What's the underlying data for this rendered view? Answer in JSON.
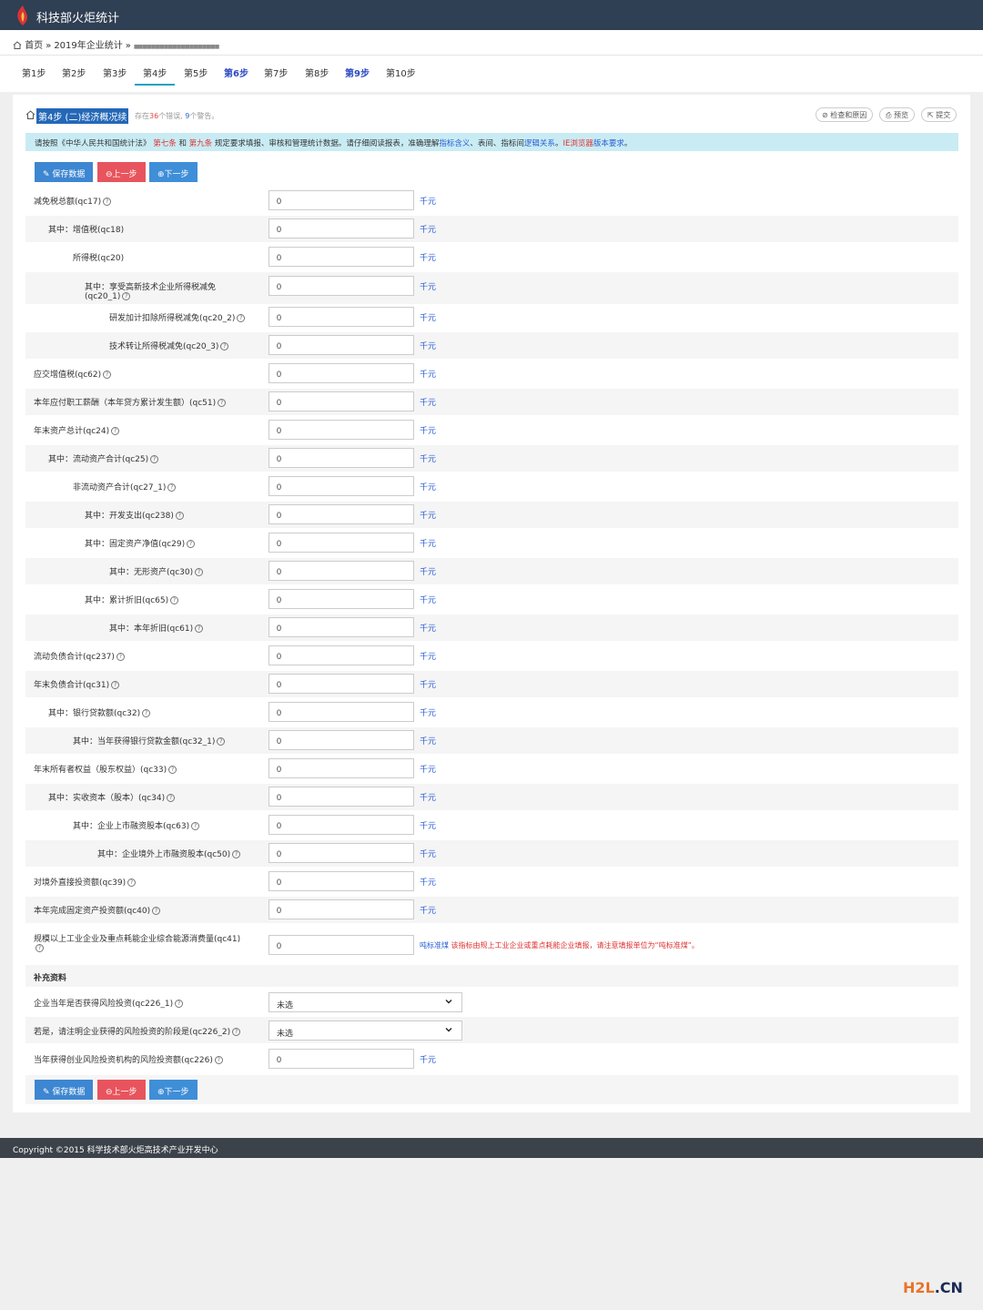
{
  "app": {
    "title": "科技部火炬统计"
  },
  "breadcrumb": {
    "home": "首页",
    "sep": "»",
    "survey": "2019年企业统计",
    "org": "■■■■■■■■■■■■■■■■■■■■"
  },
  "steps": [
    "第1步",
    "第2步",
    "第3步",
    "第4步",
    "第5步",
    "第6步",
    "第7步",
    "第8步",
    "第9步",
    "第10步"
  ],
  "panel": {
    "title": "第4步 (二)经济概况续",
    "stats_prefix": "存在",
    "error_count": "36",
    "stats_mid": "个错误, ",
    "warning_count": "9",
    "stats_suffix": "个警告。",
    "btn_check": "检查和原因",
    "btn_preview": "预览",
    "btn_submit": "提交"
  },
  "notice": {
    "p1": "请按照《中华人民共和国统计法》",
    "art7": "第七条",
    "and": "和",
    "art9": "第九条",
    "p2": "规定要求填报、审核和管理统计数据。请仔细阅读报表，准确理解",
    "link1": "指标含义",
    "p3": "、表间、指标间",
    "link2": "逻辑关系",
    "p4": "。",
    "ie": "IE浏览器",
    "link3": "版本要求",
    "p5": "。"
  },
  "toolbar": {
    "save": "保存数据",
    "prev": "上一步",
    "next": "下一步"
  },
  "unit": "千元",
  "fields": [
    {
      "label": "减免税总额(qc17)",
      "value": "0"
    },
    {
      "label": "其中：增值税(qc18)",
      "value": "0"
    },
    {
      "label": "所得税(qc20)",
      "value": "0"
    },
    {
      "label": "其中：享受高新技术企业所得税减免",
      "label2": "(qc20_1)",
      "value": "0"
    },
    {
      "label": "研发加计扣除所得税减免(qc20_2)",
      "value": "0"
    },
    {
      "label": "技术转让所得税减免(qc20_3)",
      "value": "0"
    },
    {
      "label": "应交增值税(qc62)",
      "value": "0"
    },
    {
      "label": "本年应付职工薪酬（本年贷方累计发生额）(qc51)",
      "value": "0"
    },
    {
      "label": "年末资产总计(qc24)",
      "value": "0"
    },
    {
      "label": "其中：流动资产合计(qc25)",
      "value": "0"
    },
    {
      "label": "非流动资产合计(qc27_1)",
      "value": "0"
    },
    {
      "label": "其中：开发支出(qc238)",
      "value": "0"
    },
    {
      "label": "其中：固定资产净值(qc29)",
      "value": "0"
    },
    {
      "label": "其中：无形资产(qc30)",
      "value": "0"
    },
    {
      "label": "其中：累计折旧(qc65)",
      "value": "0"
    },
    {
      "label": "其中：本年折旧(qc61)",
      "value": "0"
    },
    {
      "label": "流动负债合计(qc237)",
      "value": "0"
    },
    {
      "label": "年末负债合计(qc31)",
      "value": "0"
    },
    {
      "label": "其中：银行贷款额(qc32)",
      "value": "0"
    },
    {
      "label": "其中：当年获得银行贷款金额(qc32_1)",
      "value": "0"
    },
    {
      "label": "年末所有者权益（股东权益）(qc33)",
      "value": "0"
    },
    {
      "label": "其中：实收资本（股本）(qc34)",
      "value": "0"
    },
    {
      "label": "其中：企业上市融资股本(qc63)",
      "value": "0"
    },
    {
      "label": "其中：企业境外上市融资股本(qc50)",
      "value": "0"
    },
    {
      "label": "对境外直接投资额(qc39)",
      "value": "0"
    },
    {
      "label": "本年完成固定资产投资额(qc40)",
      "value": "0"
    },
    {
      "label": "规模以上工业企业及重点耗能企业综合能源消费量(qc41)",
      "value": "0"
    }
  ],
  "energy_hint": {
    "unit": "吨标准煤",
    "note": "该指标由规上工业企业或重点耗能企业填报，请注意填报单位为“吨标准煤”。"
  },
  "supplement": {
    "title": "补充资料",
    "q1_label": "企业当年是否获得风险投资(qc226_1)",
    "q1_value": "未选",
    "q2_label": "若是，请注明企业获得的风险投资的阶段是(qc226_2)",
    "q2_value": "未选",
    "q3_label": "当年获得创业风险投资机构的风险投资额(qc226)",
    "q3_value": "0"
  },
  "footer": {
    "copyright": "Copyright ©2015 科学技术部火炬高技术产业开发中心"
  },
  "watermark": {
    "a": "H2L",
    "b": ".CN"
  }
}
